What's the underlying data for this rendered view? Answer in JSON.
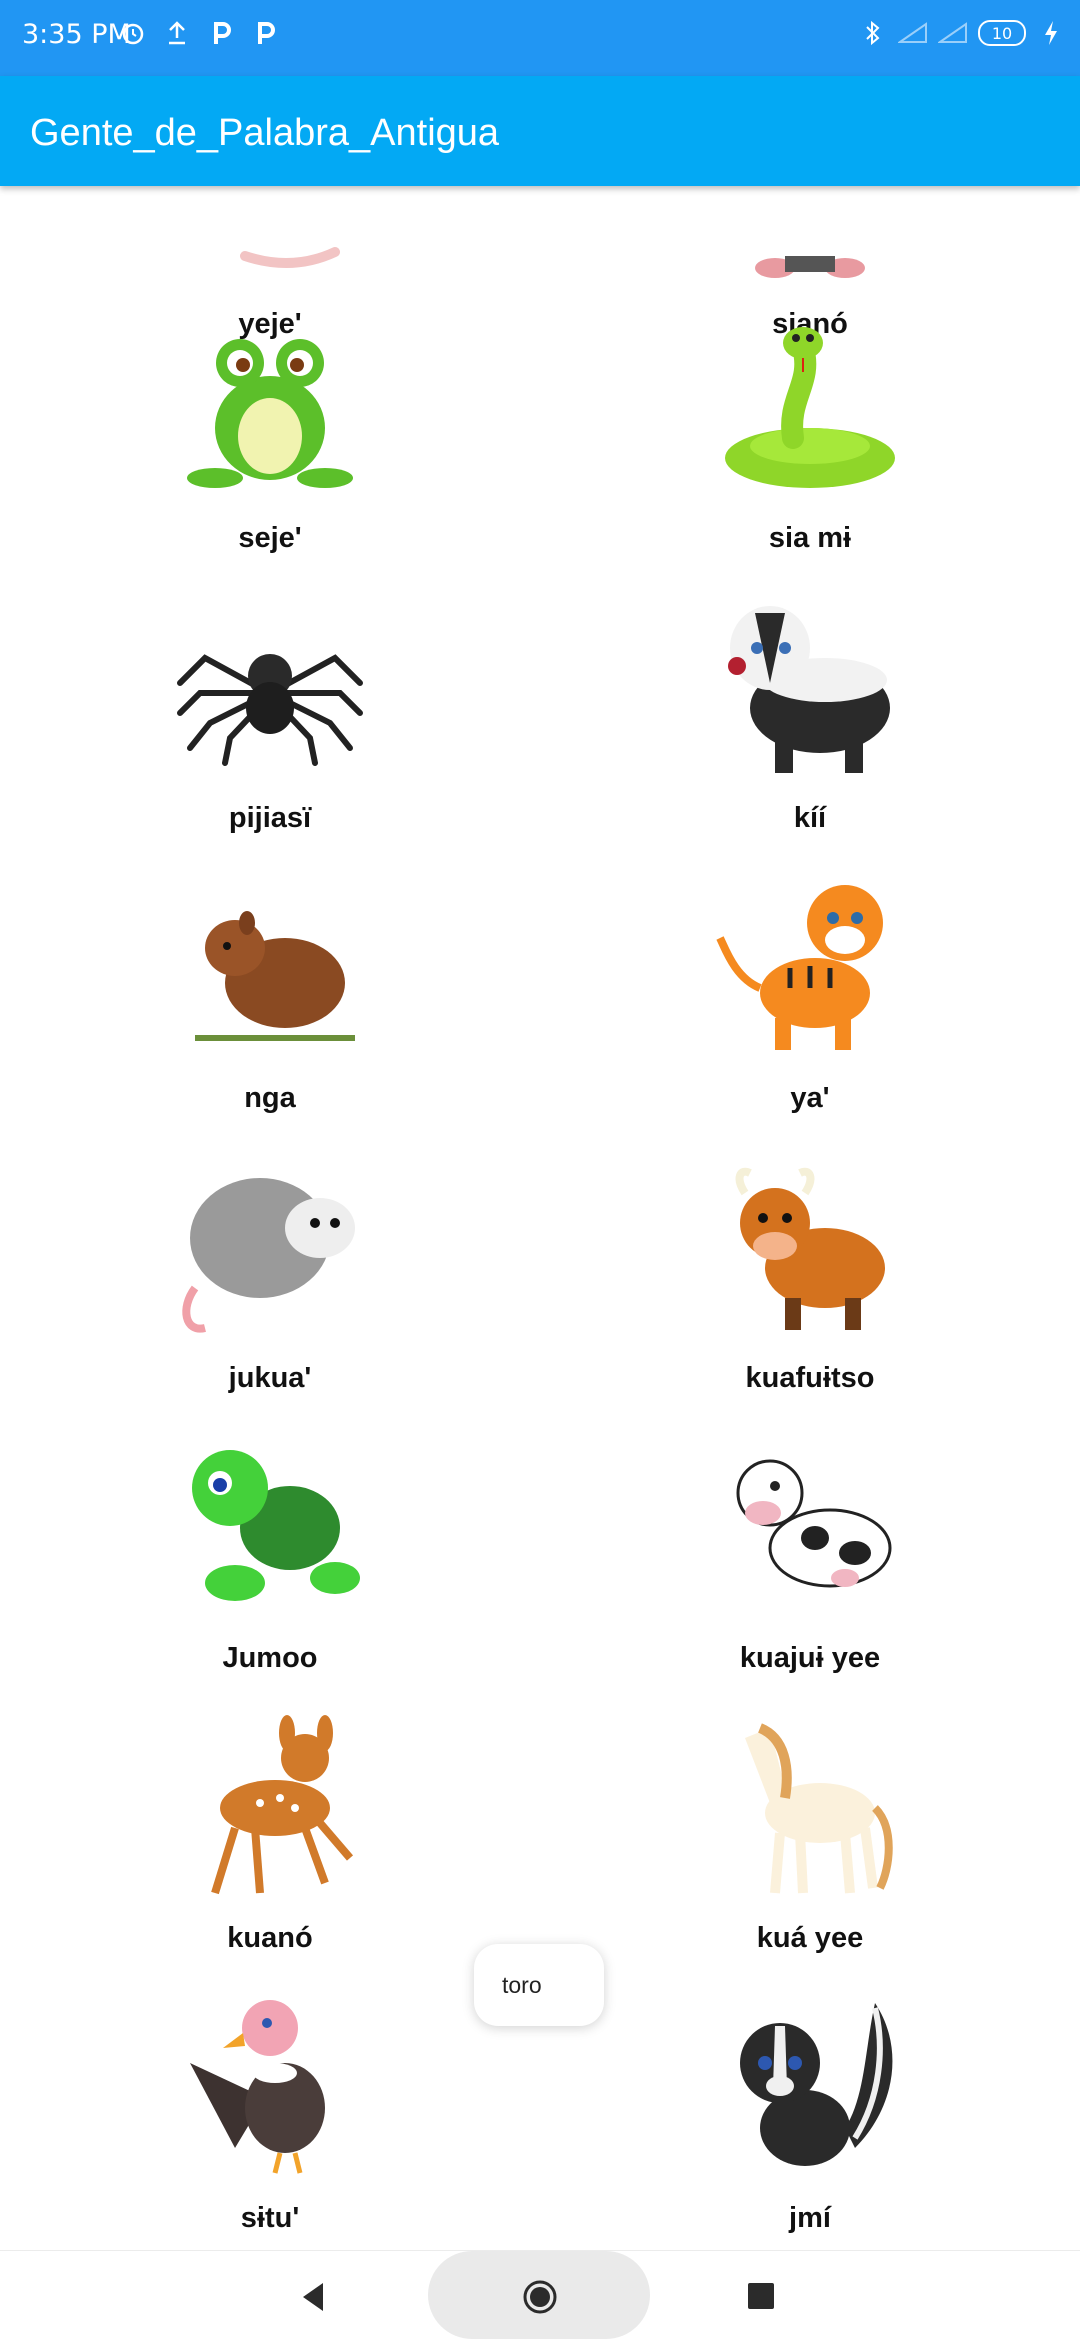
{
  "status": {
    "time": "3:35 PM",
    "battery": "10",
    "left_icons": [
      "alarm-icon",
      "upload-icon",
      "p-icon",
      "p-icon"
    ],
    "right_icons": [
      "bluetooth-icon",
      "signal-icon",
      "signal-icon",
      "battery-icon",
      "charging-icon"
    ]
  },
  "app": {
    "title": "Gente_de_Palabra_Antigua",
    "accent": "#03a9f4",
    "status_color": "#2196f3"
  },
  "grid": [
    {
      "label": "yeje'",
      "icon": "worm-icon"
    },
    {
      "label": "sianó",
      "icon": "mole-icon"
    },
    {
      "label": "seje'",
      "icon": "frog-icon"
    },
    {
      "label": "sia mɨ",
      "icon": "snake-icon"
    },
    {
      "label": "pijiasï",
      "icon": "spider-icon"
    },
    {
      "label": "kíí",
      "icon": "badger-icon"
    },
    {
      "label": "nga",
      "icon": "agouti-icon"
    },
    {
      "label": "ya'",
      "icon": "tiger-icon"
    },
    {
      "label": "jukua'",
      "icon": "opossum-icon"
    },
    {
      "label": "kuafuɨtso",
      "icon": "bull-icon"
    },
    {
      "label": "Jumoo",
      "icon": "turtle-icon"
    },
    {
      "label": "kuajuɨ yee",
      "icon": "cow-icon"
    },
    {
      "label": "kuanó",
      "icon": "deer-icon"
    },
    {
      "label": "kuá yee",
      "icon": "horse-icon"
    },
    {
      "label": "sɨtu'",
      "icon": "vulture-icon"
    },
    {
      "label": "jmí",
      "icon": "skunk-icon"
    }
  ],
  "toast": {
    "text": "toro"
  },
  "nav": {
    "back": "back-icon",
    "home": "home-icon",
    "recent": "recent-apps-icon"
  }
}
